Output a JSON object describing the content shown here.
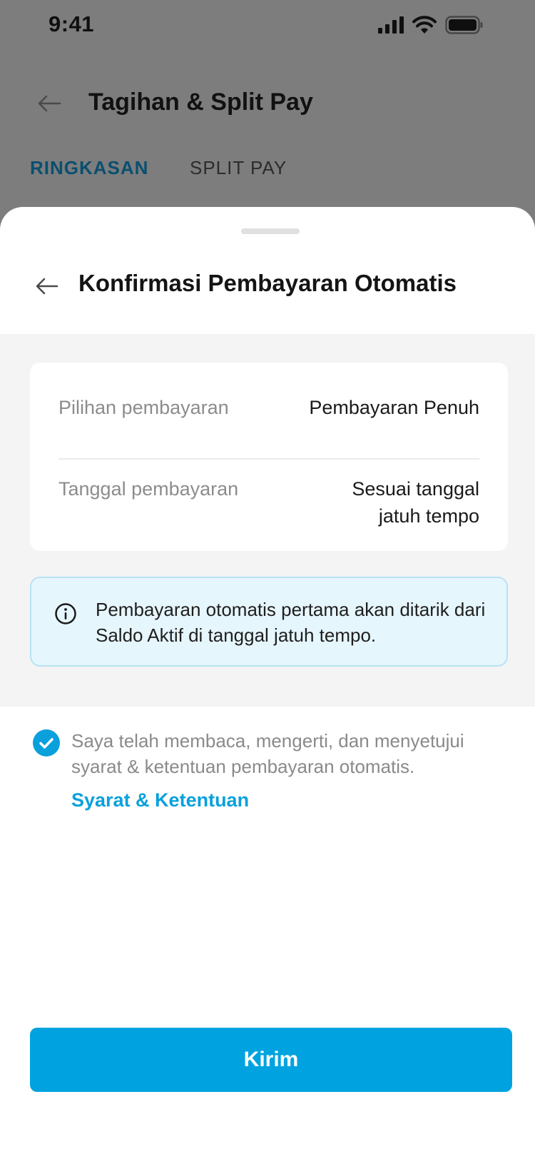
{
  "status_bar": {
    "time": "9:41",
    "icons": [
      "signal-icon",
      "wifi-icon",
      "battery-icon"
    ]
  },
  "background_screen": {
    "title": "Tagihan & Split Pay",
    "back_icon": "arrow-left-icon",
    "tabs": [
      {
        "label": "RINGKASAN",
        "active": true
      },
      {
        "label": "SPLIT PAY",
        "active": false
      }
    ]
  },
  "sheet": {
    "title": "Konfirmasi Pembayaran Otomatis",
    "back_icon": "arrow-left-icon",
    "summary": {
      "rows": [
        {
          "label": "Pilihan pembayaran",
          "value": "Pembayaran Penuh"
        },
        {
          "label": "Tanggal pembayaran",
          "value": "Sesuai tanggal jatuh tempo"
        }
      ]
    },
    "info": {
      "icon": "info-icon",
      "text": "Pembayaran otomatis pertama akan ditarik dari Saldo Aktif di tanggal jatuh tempo."
    },
    "agreement": {
      "checked": true,
      "text": "Saya telah membaca, mengerti, dan menyetujui syarat & ketentuan pembayaran otomatis.",
      "link_label": "Syarat & Ketentuan"
    },
    "submit_label": "Kirim"
  },
  "colors": {
    "accent": "#00a3df",
    "tab_active": "#0a4f6f",
    "overlay": "#7d7d7d",
    "info_bg": "#e6f6fd",
    "info_border": "#b6e3f5"
  }
}
